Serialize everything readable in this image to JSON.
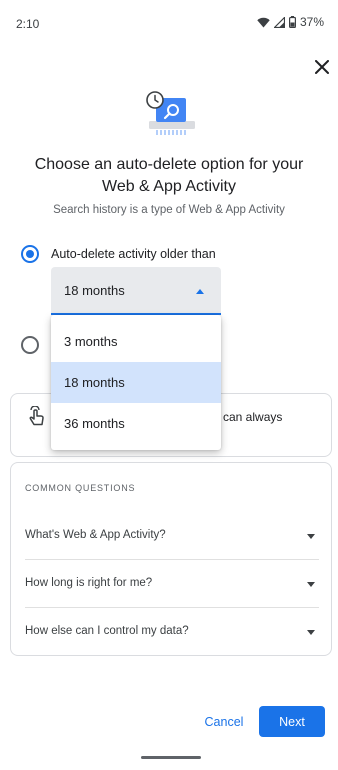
{
  "status_bar": {
    "time": "2:10",
    "battery_percent": "37%",
    "icons": [
      "wifi-icon",
      "signal-icon",
      "battery-icon"
    ]
  },
  "header": {
    "close_icon": "close-icon"
  },
  "illustration": {
    "icon": "auto-delete-clock-search-icon"
  },
  "title": "Choose an auto-delete option for your Web & App Activity",
  "subtitle": "Search history is a type of Web & App Activity",
  "options": {
    "auto_delete": {
      "label": "Auto-delete activity older than",
      "checked": true
    },
    "second_option": {
      "checked": false
    }
  },
  "select": {
    "value": "18 months",
    "menu_open": true,
    "options": [
      "3 months",
      "18 months",
      "36 months"
    ],
    "selected_index": 1
  },
  "info_card": {
    "icon": "hand-tap-icon",
    "visible_text": "can always"
  },
  "faq": {
    "heading": "COMMON QUESTIONS",
    "items": [
      {
        "question": "What's Web & App Activity?"
      },
      {
        "question": "How long is right for me?"
      },
      {
        "question": "How else can I control my data?"
      }
    ]
  },
  "footer": {
    "cancel_label": "Cancel",
    "next_label": "Next"
  },
  "colors": {
    "accent": "#1a73e8",
    "selected_item_bg": "#d2e3fc",
    "field_bg": "#e8eaed"
  }
}
